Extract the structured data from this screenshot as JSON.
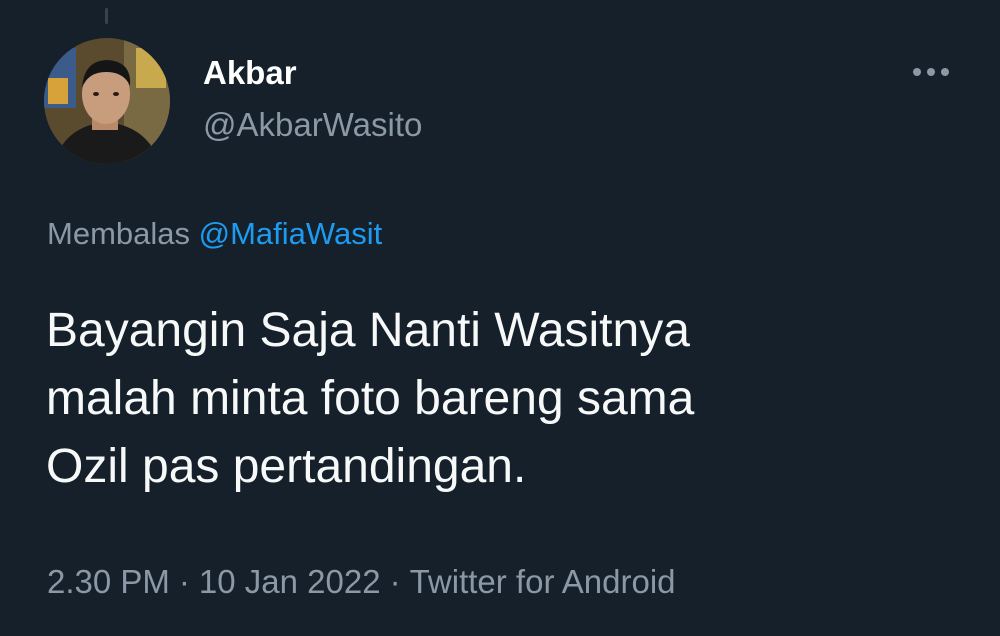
{
  "author": {
    "display_name": "Akbar",
    "handle": "@AkbarWasito"
  },
  "more_icon": "more-horizontal-icon",
  "reply": {
    "prefix": "Membalas",
    "to": "@MafiaWasit"
  },
  "tweet": {
    "lines": [
      "Bayangin Saja Nanti Wasitnya",
      "malah minta foto bareng sama",
      "Ozil pas pertandingan."
    ]
  },
  "meta": {
    "time": "2.30 PM",
    "separator": "·",
    "date": "10 Jan 2022",
    "source": "Twitter for Android"
  },
  "colors": {
    "background": "#15202b",
    "primary_text": "#f7f9f9",
    "secondary_text": "#8b98a5",
    "accent": "#1d9bf0"
  }
}
